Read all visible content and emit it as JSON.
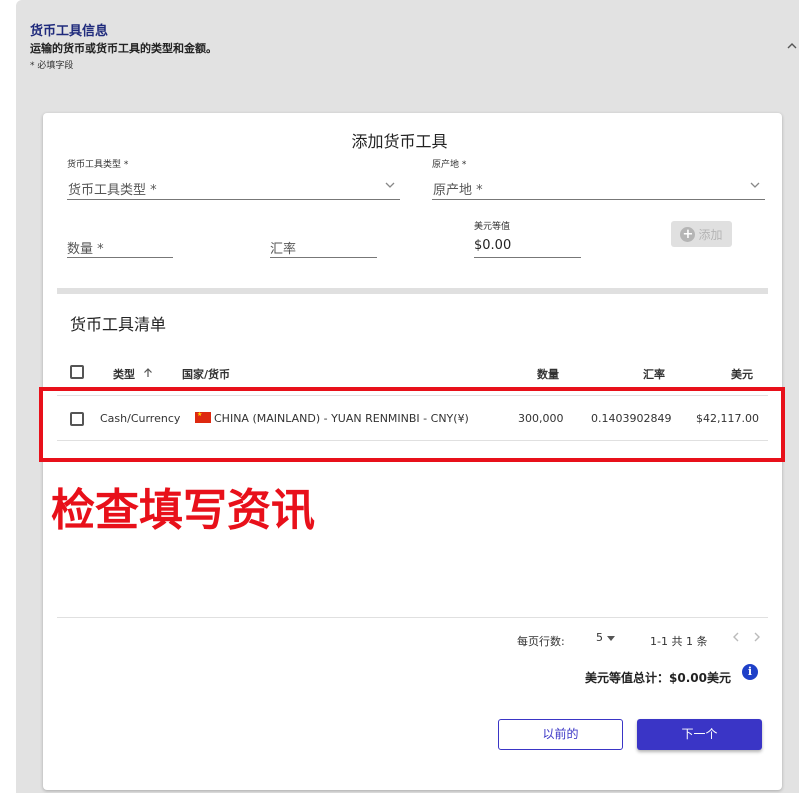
{
  "section": {
    "title": "货币工具信息",
    "description": "运输的货币或货币工具的类型和金额。",
    "required_note": "* 必填字段"
  },
  "form": {
    "title": "添加货币工具",
    "instrument_type_label": "货币工具类型",
    "instrument_type_placeholder": "货币工具类型",
    "origin_label": "原产地",
    "origin_placeholder": "原产地",
    "required_star": "*",
    "quantity_placeholder": "数量",
    "rate_placeholder": "汇率",
    "usd_equiv_label": "美元等值",
    "usd_equiv_value": "$0.00",
    "add_button": "添加"
  },
  "list": {
    "title": "货币工具清单",
    "columns": {
      "type": "类型",
      "sort_icon": "arrow-up-icon",
      "country": "国家/货币",
      "quantity": "数量",
      "rate": "汇率",
      "usd": "美元"
    },
    "rows": [
      {
        "type": "Cash/Currency",
        "flag": "china-flag",
        "country": "CHINA (MAINLAND) - YUAN RENMINBI - CNY(¥)",
        "quantity": "300,000",
        "rate": "0.1403902849",
        "usd": "$42,117.00"
      }
    ]
  },
  "annotation": {
    "text": "检查填写资讯",
    "color": "#e8101a"
  },
  "pagination": {
    "rows_per_page_label": "每页行数:",
    "rows_per_page_value": "5",
    "range": "1-1 共 1 条"
  },
  "total": {
    "text": "美元等值总计：$0.00美元"
  },
  "buttons": {
    "previous": "以前的",
    "next": "下一个"
  },
  "colors": {
    "primary": "#3a35c6",
    "title": "#1f2a7c",
    "info": "#1e40c8"
  }
}
